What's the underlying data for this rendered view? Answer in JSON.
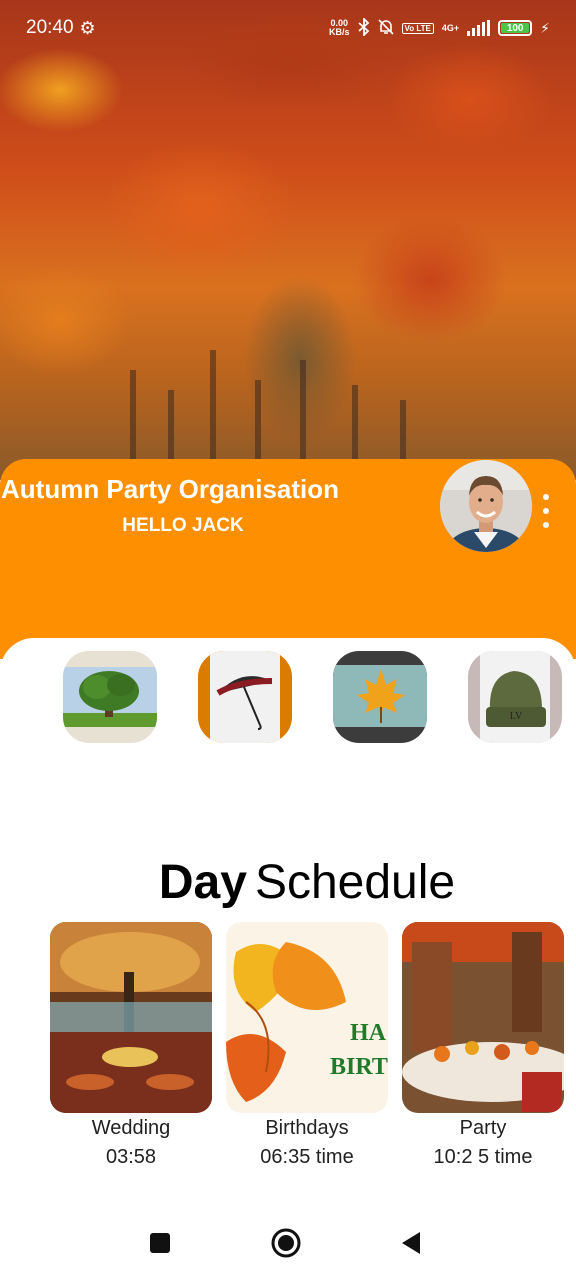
{
  "status_bar": {
    "time": "20:40",
    "net_speed_value": "0.00",
    "net_speed_unit": "KB/s",
    "volte": "Vo LTE",
    "network": "4G+",
    "battery": "100"
  },
  "header": {
    "title": "Autumn Party Organisation",
    "greeting": "HELLO JACK"
  },
  "categories": [
    {
      "icon": "tree-icon"
    },
    {
      "icon": "umbrella-icon"
    },
    {
      "icon": "maple-leaf-icon"
    },
    {
      "icon": "beanie-hat-icon"
    }
  ],
  "schedule": {
    "title_bold": "Day",
    "title_light": "Schedule",
    "items": [
      {
        "name": "Wedding",
        "time": "03:58"
      },
      {
        "name": "Birthdays",
        "time": "06:35 time",
        "image_text_1": "HA",
        "image_text_2": "BIRT"
      },
      {
        "name": "Party",
        "time": "10:2 5 time"
      }
    ]
  },
  "colors": {
    "accent": "#fd8f00",
    "panel": "#ffffff"
  }
}
